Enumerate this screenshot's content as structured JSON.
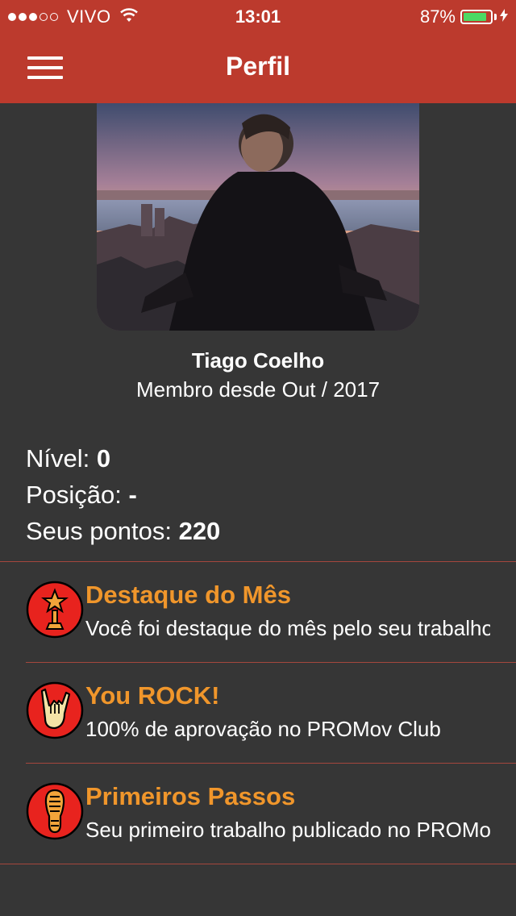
{
  "status_bar": {
    "carrier": "VIVO",
    "signal_dots_full": 3,
    "signal_dots_total": 5,
    "time": "13:01",
    "battery_percent": "87%",
    "battery_level": 0.87,
    "wifi_icon": "wifi-icon",
    "charging_icon": "bolt-icon"
  },
  "header": {
    "title": "Perfil",
    "menu_icon": "hamburger-menu-icon",
    "background_color": "#bc3a2d"
  },
  "profile": {
    "name": "Tiago Coelho",
    "member_since": "Membro desde Out / 2017"
  },
  "stats": {
    "level_label": "Nível: ",
    "level_value": "0",
    "position_label": "Posição: ",
    "position_value": "-",
    "points_label": "Seus pontos: ",
    "points_value": "220"
  },
  "badges": [
    {
      "title": "Destaque do Mês",
      "description": "Você foi destaque do mês pelo seu trabalho",
      "icon": "trophy-star-icon"
    },
    {
      "title": "You ROCK!",
      "description": "100% de aprovação no PROMov Club",
      "icon": "rock-hand-icon"
    },
    {
      "title": "Primeiros Passos",
      "description": "Seu primeiro trabalho publicado no PROMov Club",
      "icon": "footprint-icon"
    }
  ],
  "colors": {
    "background": "#363636",
    "accent_orange": "#f0962b",
    "badge_red": "#e8231e",
    "divider": "#a5473d"
  }
}
